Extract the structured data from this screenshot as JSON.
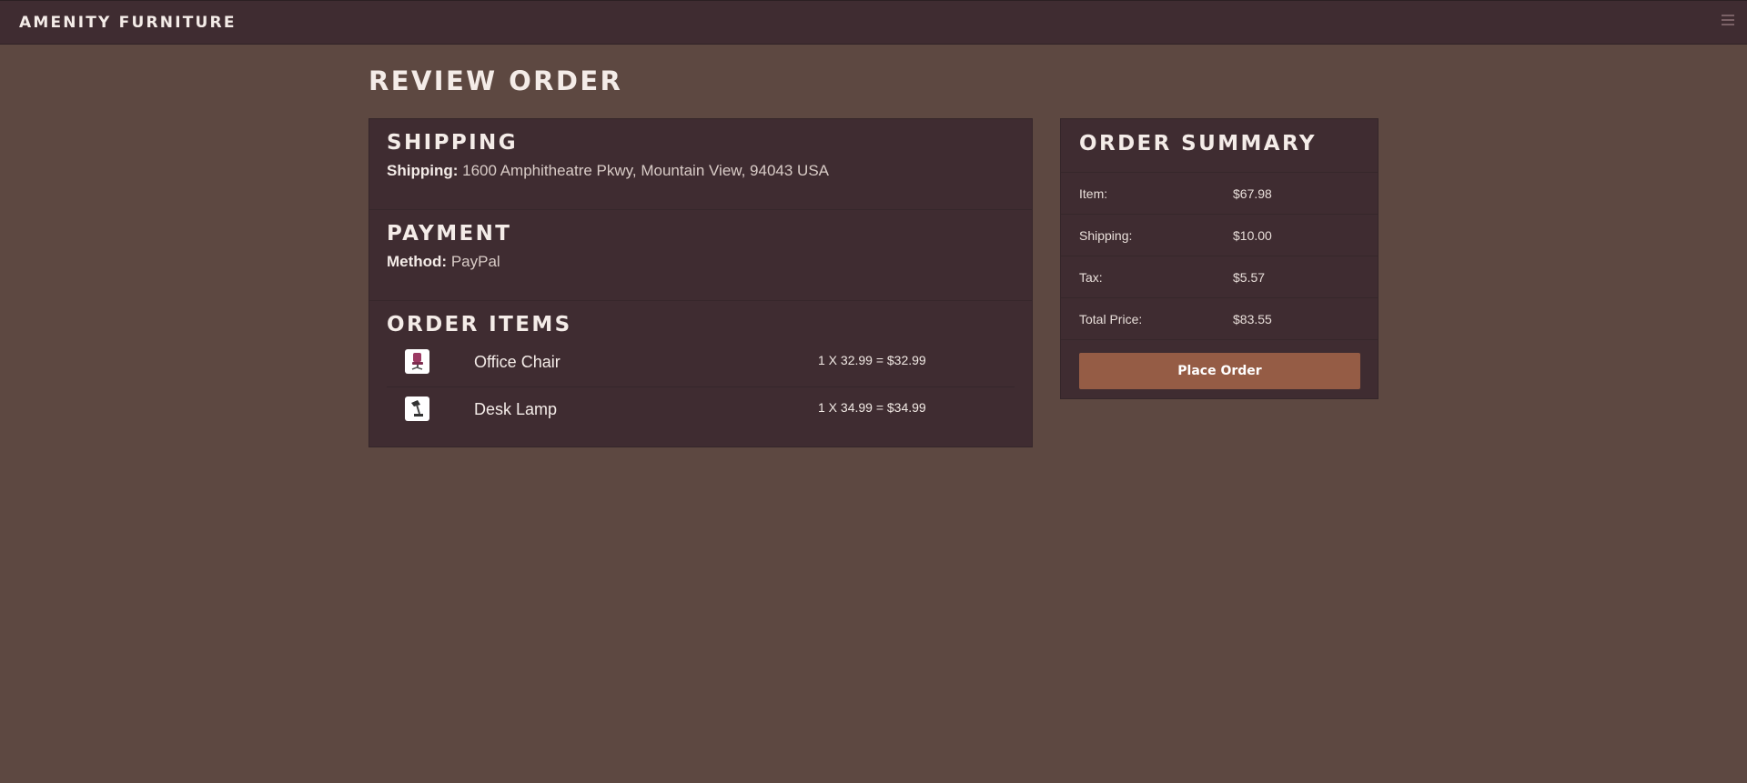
{
  "header": {
    "brand": "AMENITY FURNITURE",
    "menu_icon": "hamburger-icon"
  },
  "page": {
    "title": "REVIEW ORDER"
  },
  "shipping": {
    "heading": "SHIPPING",
    "label": "Shipping:",
    "address": "1600 Amphitheatre Pkwy, Mountain View, 94043 USA"
  },
  "payment": {
    "heading": "PAYMENT",
    "label": "Method:",
    "method": "PayPal"
  },
  "order_items": {
    "heading": "ORDER ITEMS",
    "items": [
      {
        "name": "Office Chair",
        "price_line": "1 X 32.99 = $32.99",
        "icon": "office-chair-thumbnail"
      },
      {
        "name": "Desk Lamp",
        "price_line": "1 X 34.99 = $34.99",
        "icon": "desk-lamp-thumbnail"
      }
    ]
  },
  "summary": {
    "heading": "ORDER SUMMARY",
    "rows": [
      {
        "label": "Item:",
        "value": "$67.98"
      },
      {
        "label": "Shipping:",
        "value": "$10.00"
      },
      {
        "label": "Tax:",
        "value": "$5.57"
      },
      {
        "label": "Total Price:",
        "value": "$83.55"
      }
    ],
    "button_label": "Place Order"
  },
  "colors": {
    "background": "#5d4841",
    "panel": "#3f2c31",
    "accent_button": "#955c45"
  }
}
